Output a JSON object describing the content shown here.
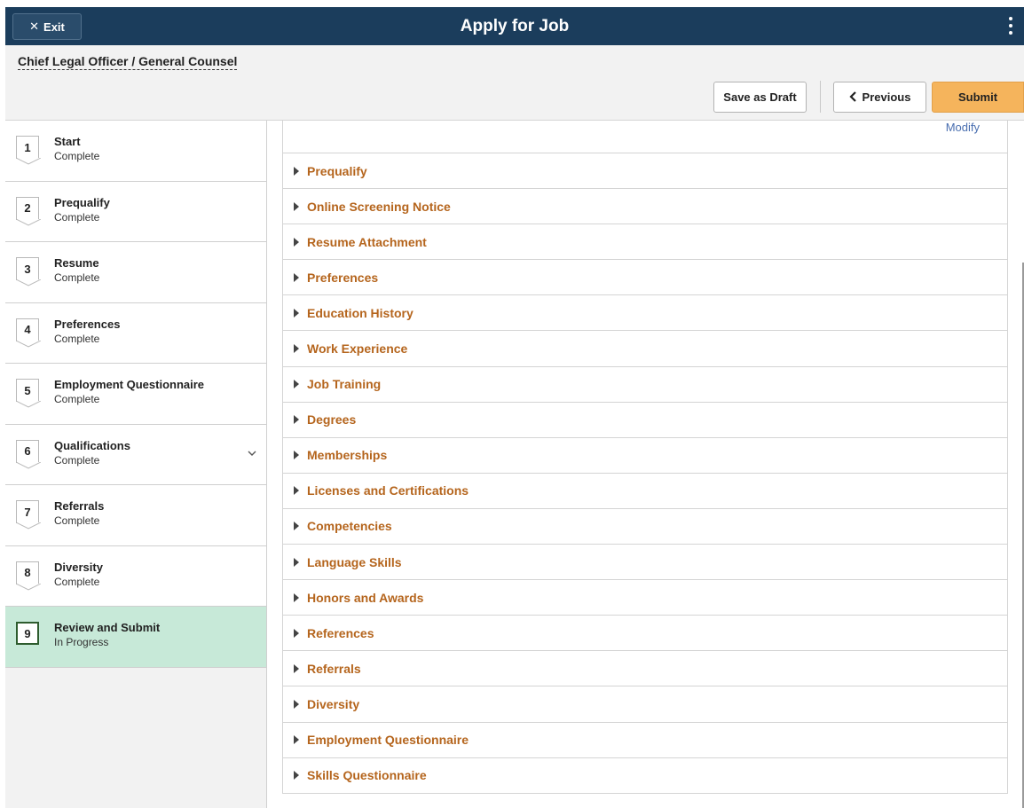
{
  "header": {
    "exit_label": "Exit",
    "title": "Apply for Job"
  },
  "job": {
    "title": "Chief Legal Officer / General Counsel"
  },
  "toolbar": {
    "save_draft_label": "Save as Draft",
    "previous_label": "Previous",
    "submit_label": "Submit"
  },
  "steps": [
    {
      "number": "1",
      "name": "Start",
      "status": "Complete"
    },
    {
      "number": "2",
      "name": "Prequalify",
      "status": "Complete"
    },
    {
      "number": "3",
      "name": "Resume",
      "status": "Complete"
    },
    {
      "number": "4",
      "name": "Preferences",
      "status": "Complete"
    },
    {
      "number": "5",
      "name": "Employment Questionnaire",
      "status": "Complete"
    },
    {
      "number": "6",
      "name": "Qualifications",
      "status": "Complete"
    },
    {
      "number": "7",
      "name": "Referrals",
      "status": "Complete"
    },
    {
      "number": "8",
      "name": "Diversity",
      "status": "Complete"
    },
    {
      "number": "9",
      "name": "Review and Submit",
      "status": "In Progress"
    }
  ],
  "main": {
    "modify_label": "Modify",
    "sections": [
      "Prequalify",
      "Online Screening Notice",
      "Resume Attachment",
      "Preferences",
      "Education History",
      "Work Experience",
      "Job Training",
      "Degrees",
      "Memberships",
      "Licenses and Certifications",
      "Competencies",
      "Language Skills",
      "Honors and Awards",
      "References",
      "Referrals",
      "Diversity",
      "Employment Questionnaire",
      "Skills Questionnaire"
    ]
  },
  "colors": {
    "banner": "#1b3d5c",
    "submit_button": "#f5b45c",
    "active_step": "#c7e9d8",
    "section_link": "#b5651d",
    "modify_link": "#4a6fb0"
  },
  "icons": {
    "exit": "close-icon",
    "menu": "kebab-menu-icon",
    "previous": "chevron-left-icon",
    "expand_step": "chevron-down-icon",
    "section": "triangle-right-icon"
  }
}
